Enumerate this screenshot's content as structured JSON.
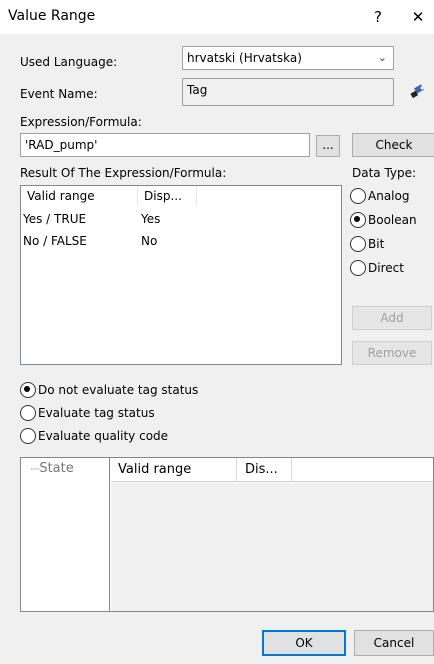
{
  "window": {
    "title": "Value Range",
    "help_glyph": "?",
    "close_glyph": "✕"
  },
  "used_language": {
    "label": "Used Language:",
    "value": "hrvatski (Hrvatska)"
  },
  "event_name": {
    "label": "Event Name:",
    "value": "Tag",
    "icon": "tag-browse-icon"
  },
  "expression": {
    "label": "Expression/Formula:",
    "value": "'RAD_pump'",
    "browse_label": "...",
    "check_label": "Check"
  },
  "result": {
    "label": "Result Of The Expression/Formula:",
    "columns": [
      "Valid range",
      "Disp..."
    ],
    "rows": [
      {
        "range": "Yes / TRUE",
        "display": "Yes"
      },
      {
        "range": "No / FALSE",
        "display": "No"
      }
    ]
  },
  "data_type": {
    "label": "Data Type:",
    "options": [
      {
        "label": "Analog",
        "checked": false
      },
      {
        "label": "Boolean",
        "checked": true
      },
      {
        "label": "Bit",
        "checked": false
      },
      {
        "label": "Direct",
        "checked": false
      }
    ]
  },
  "actions": {
    "add_label": "Add",
    "remove_label": "Remove"
  },
  "evaluation": {
    "options": [
      {
        "label": "Do not evaluate tag status",
        "checked": true
      },
      {
        "label": "Evaluate tag status",
        "checked": false
      },
      {
        "label": "Evaluate quality code",
        "checked": false
      }
    ]
  },
  "state_tree": {
    "root_label": "State",
    "connector": "·····"
  },
  "state_grid": {
    "columns": [
      "Valid range",
      "Dis..."
    ]
  },
  "footer": {
    "ok_label": "OK",
    "cancel_label": "Cancel"
  }
}
